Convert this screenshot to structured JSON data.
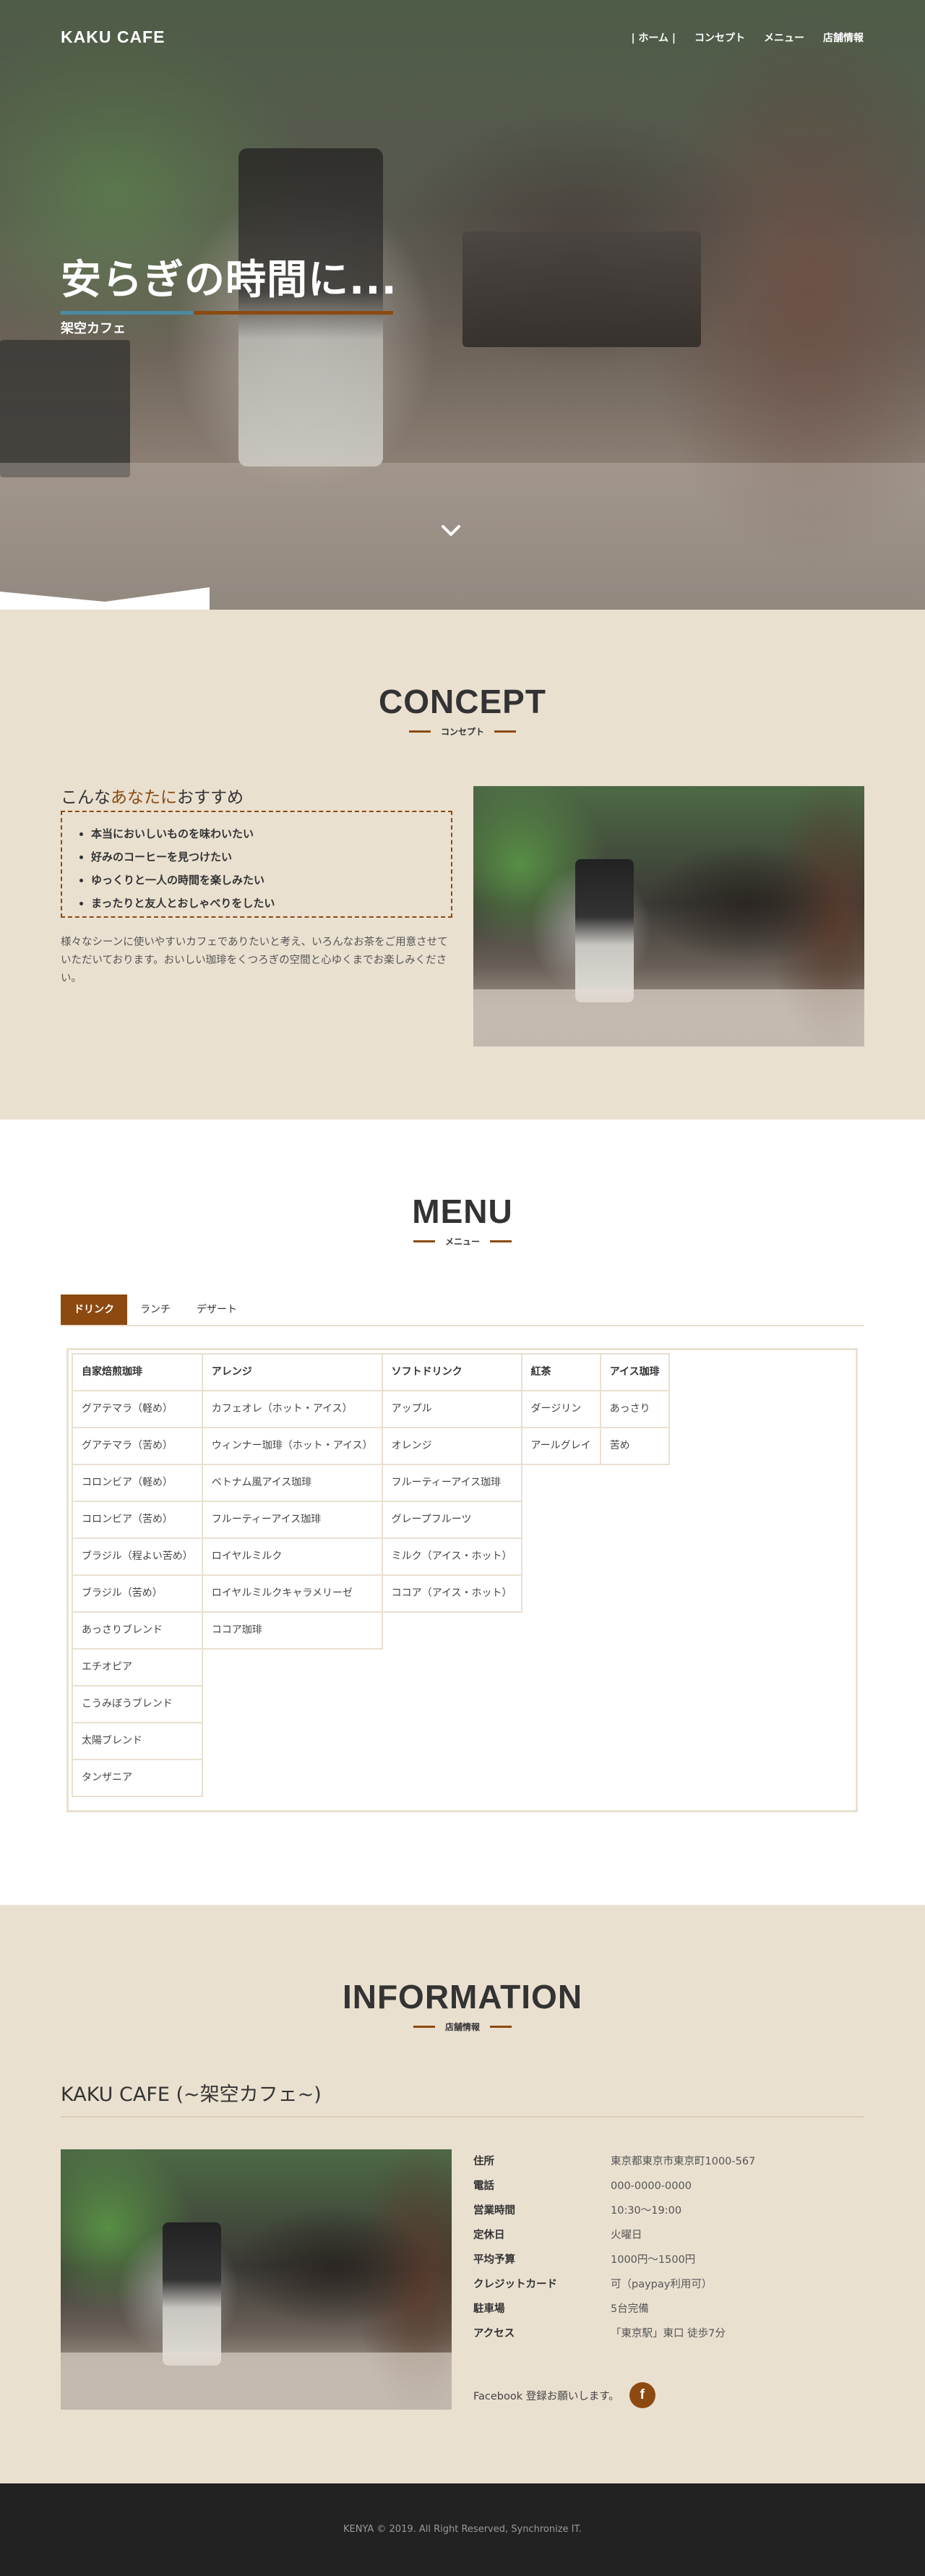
{
  "header": {
    "logo": "KAKU CAFE",
    "nav": [
      "| ホーム |",
      "コンセプト",
      "メニュー",
      "店舗情報"
    ]
  },
  "hero": {
    "title": "安らぎの時間に...",
    "subtitle": "架空カフェ",
    "scroll_icon": "chevron-down-icon"
  },
  "concept": {
    "title": "CONCEPT",
    "subtitle": "コンセプト",
    "lead_before": "こんな",
    "lead_highlight": "あなたに",
    "lead_after": "おすすめ",
    "recommendations": [
      "本当においしいものを味わいたい",
      "好みのコーヒーを見つけたい",
      "ゆっくりと一人の時間を楽しみたい",
      "まったりと友人とおしゃべりをしたい"
    ],
    "text": "様々なシーンに使いやすいカフェでありたいと考え、いろんなお茶をご用意させていただいております。おいしい珈琲をくつろぎの空間と心ゆくまでお楽しみください。"
  },
  "menu": {
    "title": "MENU",
    "subtitle": "メニュー",
    "tabs": [
      "ドリンク",
      "ランチ",
      "デザート"
    ],
    "active_tab": "ドリンク",
    "columns": [
      {
        "header": "自家焙煎珈琲",
        "items": [
          "グアテマラ（軽め）",
          "グアテマラ（苦め）",
          "コロンビア（軽め）",
          "コロンビア（苦め）",
          "ブラジル（程よい苦め）",
          "ブラジル（苦め）",
          "あっさりブレンド",
          "エチオピア",
          "こうみぼうブレンド",
          "太陽ブレンド",
          "タンザニア"
        ]
      },
      {
        "header": "アレンジ",
        "items": [
          "カフェオレ（ホット・アイス）",
          "ウィンナー珈琲（ホット・アイス）",
          "ベトナム風アイス珈琲",
          "フルーティーアイス珈琲",
          "ロイヤルミルク",
          "ロイヤルミルクキャラメリーゼ",
          "ココア珈琲"
        ]
      },
      {
        "header": "ソフトドリンク",
        "items": [
          "アップル",
          "オレンジ",
          "フルーティーアイス珈琲",
          "グレープフルーツ",
          "ミルク（アイス・ホット）",
          "ココア（アイス・ホット）"
        ]
      },
      {
        "header": "紅茶",
        "items": [
          "ダージリン",
          "アールグレイ"
        ]
      },
      {
        "header": "アイス珈琲",
        "items": [
          "あっさり",
          "苦め"
        ]
      }
    ]
  },
  "information": {
    "title": "INFORMATION",
    "subtitle": "店舗情報",
    "shop_name": "KAKU CAFE (~架空カフェ~)",
    "rows": [
      {
        "key": "住所",
        "value": "東京都東京市東京町1000-567"
      },
      {
        "key": "電話",
        "value": "000-0000-0000"
      },
      {
        "key": "営業時間",
        "value": "10:30〜19:00"
      },
      {
        "key": "定休日",
        "value": "火曜日"
      },
      {
        "key": "平均予算",
        "value": "1000円〜1500円"
      },
      {
        "key": "クレジットカード",
        "value": "可（paypay利用可）"
      },
      {
        "key": "駐車場",
        "value": "5台完備"
      },
      {
        "key": "アクセス",
        "value": "「東京駅」東口 徒歩7分"
      }
    ],
    "facebook_text": "Facebook 登録お願いします。",
    "facebook_icon": "facebook-icon",
    "facebook_glyph": "f"
  },
  "footer": {
    "copyright": "KENYA © 2019. All Right Reserved, Synchronize IT."
  },
  "colors": {
    "accent": "#8c4a10",
    "beige": "#e9e0d0",
    "footer": "#222222"
  }
}
